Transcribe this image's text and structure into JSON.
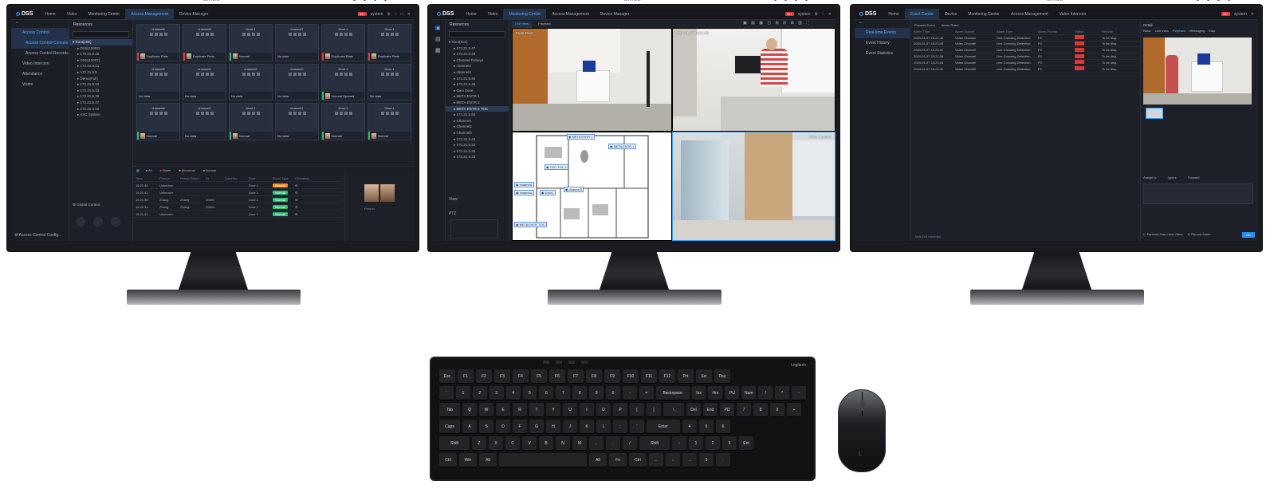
{
  "brand": "DSS",
  "monitor_logo": "alhua",
  "m1": {
    "tabs": [
      "Home",
      "Video",
      "Monitoring Center",
      "Access Management",
      "Device Manager"
    ],
    "active_tab": 3,
    "right": {
      "badge": "99+",
      "user": "system"
    },
    "nav": [
      {
        "label": "Access Control",
        "sel": true
      },
      {
        "label": "Access Control Console",
        "sub": true,
        "active": true
      },
      {
        "label": "Access Control Records",
        "sub": true
      },
      {
        "label": "Video Intercom"
      },
      {
        "label": "Attendance"
      },
      {
        "label": "Visitor"
      }
    ],
    "nav_bottom": "Access Control Config...",
    "tree_title": "Resources",
    "tree": [
      "Root(102)",
      "DSS(10002)",
      "172.21.5.46",
      "DSS(10007)",
      "172.21.5.21",
      "172.21.5.5",
      "Demo(Full)",
      "172.21.5.32",
      "172.21.5.33",
      "172.21.5.38",
      "172.21.5.47",
      "172.21.5.50",
      "ASC System"
    ],
    "tree_bottom": "Global Control",
    "cards": [
      {
        "name": "channel6",
        "foot": "Duplicate Plate",
        "foot_class": "red"
      },
      {
        "name": "channel5",
        "foot": "Duplicate Plate",
        "foot_class": "red"
      },
      {
        "name": "Door 1",
        "foot": "Normal",
        "foot_class": "green"
      },
      {
        "name": "channel7",
        "foot": "No data",
        "foot_class": ""
      },
      {
        "name": "Door 1",
        "foot": "Duplicate Plate",
        "foot_class": "red"
      },
      {
        "name": "Door 1",
        "foot": "Duplicate Plate",
        "foot_class": "red"
      },
      {
        "name": "channel6",
        "foot": "No data",
        "foot_class": ""
      },
      {
        "name": "channel2",
        "foot": "No data",
        "foot_class": ""
      },
      {
        "name": "channel2",
        "foot": "No data",
        "foot_class": ""
      },
      {
        "name": "channel3",
        "foot": "No data",
        "foot_class": ""
      },
      {
        "name": "Door 1",
        "foot": "Normal Opened",
        "foot_class": "green"
      },
      {
        "name": "Door 1",
        "foot": "No data",
        "foot_class": ""
      },
      {
        "name": "channel6",
        "foot": "Normal",
        "foot_class": "green"
      },
      {
        "name": "channel2",
        "foot": "No data",
        "foot_class": ""
      },
      {
        "name": "Door 1",
        "foot": "Normal",
        "foot_class": "green"
      },
      {
        "name": "channel1",
        "foot": "No data",
        "foot_class": ""
      },
      {
        "name": "Door 1",
        "foot": "Normal",
        "foot_class": "green"
      },
      {
        "name": "Door 1",
        "foot": "Normal",
        "foot_class": "green"
      }
    ],
    "event_filters": [
      "All",
      "Alarm",
      "Abnormal",
      "Normal"
    ],
    "event_header": [
      "Time",
      "Person",
      "Person Name",
      "ID",
      "Card No.",
      "Door",
      "Event Type",
      "Operation"
    ],
    "events": [
      {
        "time": "15:21:45",
        "person": "Unknown",
        "name": "",
        "id": "",
        "card": "",
        "door": "Door 1",
        "type": "Normal",
        "warn": true
      },
      {
        "time": "15:21:41",
        "person": "Unknown",
        "name": "",
        "id": "",
        "card": "",
        "door": "Door 1",
        "type": "Normal",
        "warn": false
      },
      {
        "time": "15:21:38",
        "person": "Zhang",
        "name": "Zhang",
        "id": "10001",
        "card": "",
        "door": "Door 1",
        "type": "Normal",
        "warn": false
      },
      {
        "time": "15:21:34",
        "person": "Zhang",
        "name": "Zhang",
        "id": "10001",
        "card": "",
        "door": "Door 1",
        "type": "Normal",
        "warn": false
      },
      {
        "time": "15:21:31",
        "person": "Unknown",
        "name": "",
        "id": "",
        "card": "",
        "door": "Door 1",
        "type": "Normal",
        "warn": false
      }
    ],
    "photo_caption": "Person"
  },
  "m2": {
    "tabs": [
      "Home",
      "Video",
      "Monitoring Center",
      "Access Management",
      "Device Manager"
    ],
    "active_tab": 2,
    "right": {
      "badge": "99+",
      "user": "system"
    },
    "tree_title": "Resources",
    "tree": [
      "Root(102)",
      "172.21.5.47",
      "172.21.5.46",
      "Channel Fisheye",
      "channel2",
      "channel3",
      "172.21.5.48",
      "172.21.5.45",
      "Cam Zone",
      "META ENTR 1",
      "META ENTR 2",
      "META ENTR 5 TOC",
      "172.21.5.50",
      "Channel1",
      "Channel2",
      "Channel3",
      "172.21.5.44",
      "172.21.5.32",
      "172.21.5.38",
      "172.21.5.33"
    ],
    "tree_sel": 11,
    "view_label": "View",
    "ptz_label": "PTZ",
    "tabs_view": [
      "Live View",
      "Playback"
    ],
    "cams": [
      {
        "label": "Front Door"
      },
      {
        "label": "2024-01-07 15:21:45"
      },
      {
        "label": "E-Map"
      },
      {
        "label": "Office Camera"
      }
    ],
    "emap_labels": [
      "META ENTR 2",
      "META ENTR 1",
      "TOC-TOC 1",
      "channel1",
      "channel2",
      "Door1",
      "channel3",
      "META ENTR TOC"
    ]
  },
  "m3": {
    "tabs": [
      "Home",
      "Event Center",
      "Device",
      "Monitoring Center",
      "Access Management",
      "Video Intercom"
    ],
    "active_tab": 1,
    "right": {
      "badge": "99+",
      "user": "system"
    },
    "nav": [
      {
        "label": "Real-time Events",
        "sel": true
      },
      {
        "label": "Event History"
      },
      {
        "label": "Event Statistics"
      }
    ],
    "toolbar": [
      "Process Event",
      "Alarm Rules"
    ],
    "header": [
      "Alarm Time",
      "Alarm Source",
      "Alarm Type",
      "Alarm Priority",
      "Status",
      "Remark"
    ],
    "rows": [
      {
        "time": "2024-01-07 15:21:45",
        "src": "Video Channel",
        "type": "Line Crossing Detection",
        "pri": "P2",
        "rm": "To be disp."
      },
      {
        "time": "2024-01-07 15:21:45",
        "src": "Video Channel",
        "type": "Line Crossing Detection",
        "pri": "P2",
        "rm": "To be disp."
      },
      {
        "time": "2024-01-07 15:21:41",
        "src": "Video Channel",
        "type": "Line Crossing Detection",
        "pri": "P2",
        "rm": "To be disp."
      },
      {
        "time": "2024-01-07 15:21:38",
        "src": "Video Channel",
        "type": "Line Crossing Detection",
        "pri": "P2",
        "rm": "To be disp."
      },
      {
        "time": "2024-01-07 15:21:34",
        "src": "Video Channel",
        "type": "Line Crossing Detection",
        "pri": "P2",
        "rm": "To be disp."
      },
      {
        "time": "2024-01-07 15:21:30",
        "src": "Video Channel",
        "type": "Line Crossing Detection",
        "pri": "P2",
        "rm": "To be disp."
      }
    ],
    "status_label": "Alarm",
    "detail_title": "Detail",
    "detail_tabs": [
      "Basic",
      "Live View",
      "Playback",
      "Messaging",
      "Map"
    ],
    "detail_form": [
      "Assign to",
      "Ignore",
      "Forward"
    ],
    "footer": "Total 100 record(s)",
    "bottom_opts": [
      "Forward Alarm Ack Video",
      "Record Alarm"
    ],
    "ok_label": "OK"
  },
  "keyboard": {
    "rows": [
      [
        "Esc",
        "F1",
        "F2",
        "F3",
        "F4",
        "F5",
        "F6",
        "F7",
        "F8",
        "F9",
        "F10",
        "F11",
        "F12",
        "Prt",
        "Scr",
        "Pau"
      ],
      [
        "`",
        "1",
        "2",
        "3",
        "4",
        "5",
        "6",
        "7",
        "8",
        "9",
        "0",
        "-",
        "=",
        "Backspace",
        "Ins",
        "Hm",
        "PU",
        "Num",
        "/",
        "*",
        "-"
      ],
      [
        "Tab",
        "Q",
        "W",
        "E",
        "R",
        "T",
        "Y",
        "U",
        "I",
        "O",
        "P",
        "[",
        "]",
        "\\",
        "Del",
        "End",
        "PD",
        "7",
        "8",
        "9",
        "+"
      ],
      [
        "Caps",
        "A",
        "S",
        "D",
        "F",
        "G",
        "H",
        "J",
        "K",
        "L",
        ";",
        "'",
        "Enter",
        "4",
        "5",
        "6"
      ],
      [
        "Shift",
        "Z",
        "X",
        "C",
        "V",
        "B",
        "N",
        "M",
        ",",
        ".",
        "/",
        "Shift",
        "↑",
        "1",
        "2",
        "3",
        "Ent"
      ],
      [
        "Ctrl",
        "Win",
        "Alt",
        "",
        "Alt",
        "Fn",
        "Ctrl",
        "←",
        "↓",
        "→",
        "0",
        "."
      ]
    ],
    "brand": "Logitech",
    "mouse_brand": "L"
  }
}
